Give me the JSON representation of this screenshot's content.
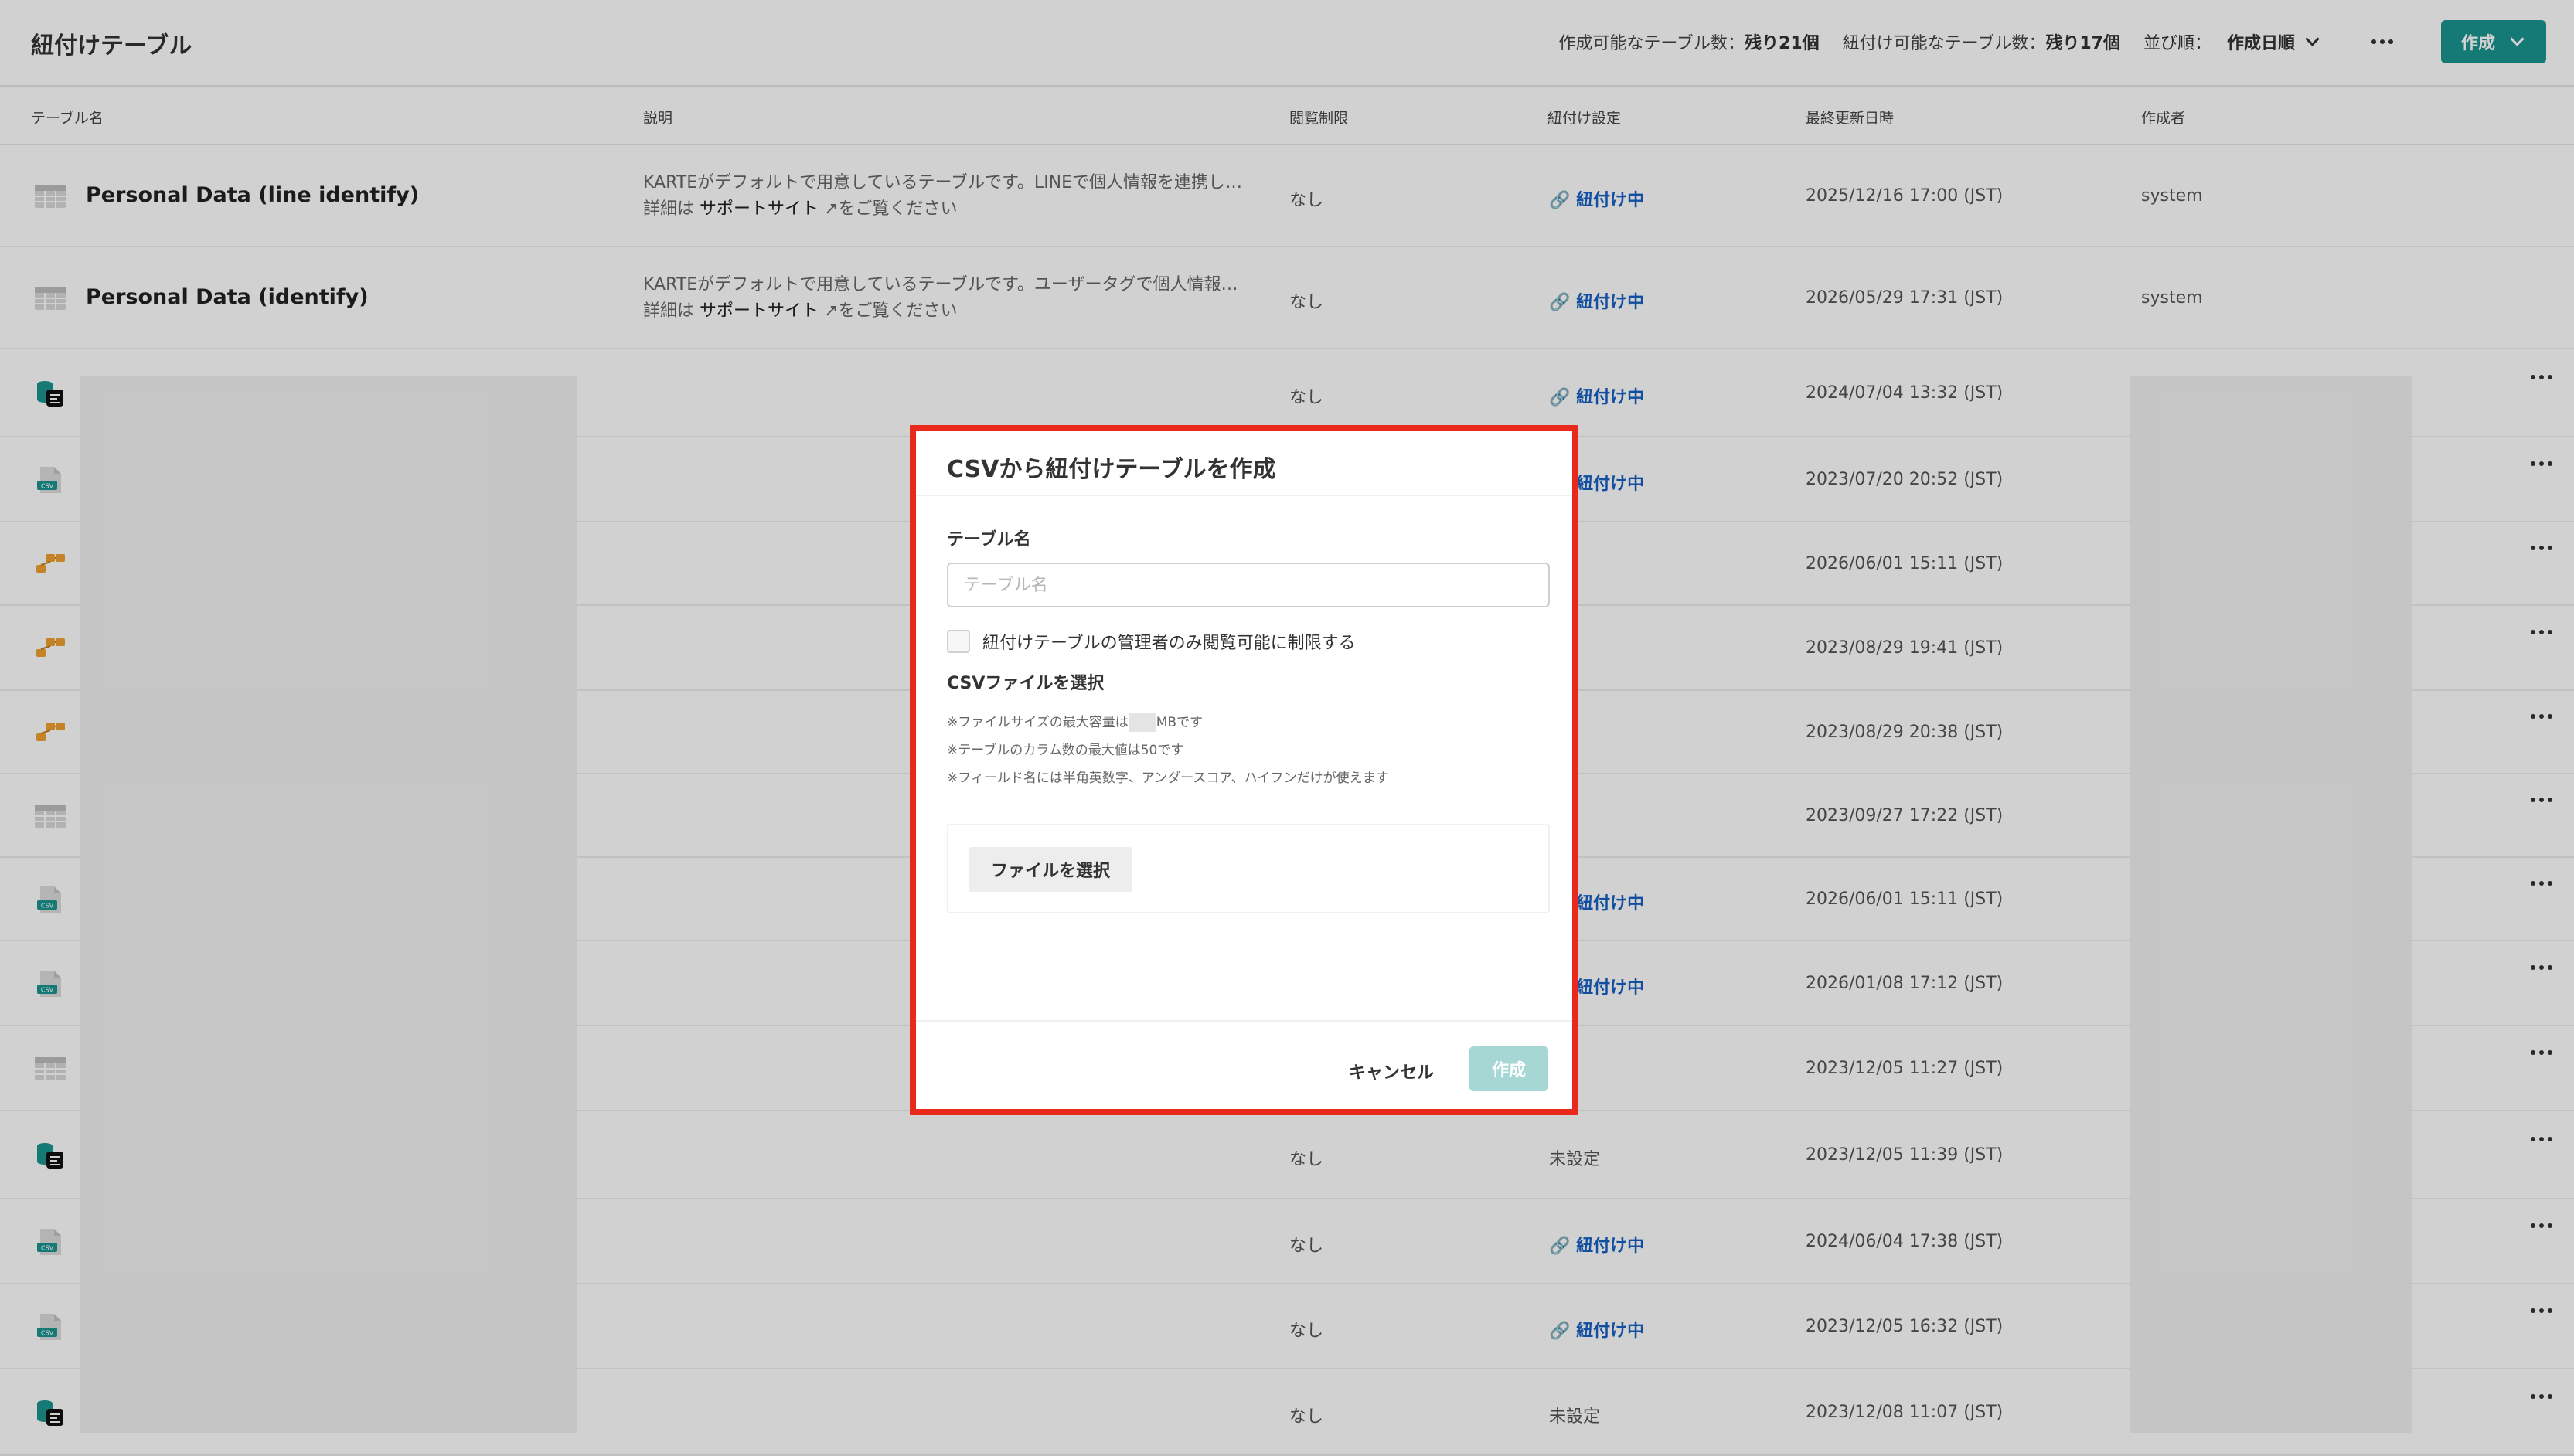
{
  "header": {
    "title": "紐付けテーブル",
    "creatable_label": "作成可能なテーブル数：",
    "creatable_value": "残り21個",
    "linkable_label": "紐付け可能なテーブル数：",
    "linkable_value": "残り17個",
    "sort_label": "並び順：",
    "sort_value": "作成日順",
    "create_button": "作成"
  },
  "columns": [
    "テーブル名",
    "説明",
    "閲覧制限",
    "紐付け設定",
    "最終更新日時",
    "作成者"
  ],
  "support_prefix": "詳細は",
  "support_link": "サポートサイト",
  "support_suffix": "をご覧ください",
  "rows": [
    {
      "icon": "table-icon",
      "name": "Personal Data (line identify)",
      "desc": "KARTEがデフォルトで用意しているテーブルです。LINEで個人情報を連携し…",
      "restriction": "なし",
      "link": "紐付け中",
      "updated": "2025/12/16 17:00 (JST)",
      "creator": "system"
    },
    {
      "icon": "table-icon",
      "name": "Personal Data (identify)",
      "desc": "KARTEがデフォルトで用意しているテーブルです。ユーザータグで個人情報…",
      "restriction": "なし",
      "link": "紐付け中",
      "updated": "2026/05/29 17:31 (JST)",
      "creator": "system"
    },
    {
      "icon": "datahub-icon",
      "restriction": "なし",
      "link": "紐付け中",
      "updated": "2024/07/04 13:32 (JST)"
    },
    {
      "icon": "csv-file-icon",
      "restriction": "",
      "link": "紐付け中",
      "updated": "2023/07/20 20:52 (JST)"
    },
    {
      "icon": "schema-icon",
      "restriction": "",
      "link": "定",
      "updated": "2026/06/01 15:11 (JST)"
    },
    {
      "icon": "schema-icon",
      "restriction": "",
      "link": "定",
      "updated": "2023/08/29 19:41 (JST)"
    },
    {
      "icon": "schema-icon",
      "restriction": "",
      "link": "定",
      "updated": "2023/08/29 20:38 (JST)"
    },
    {
      "icon": "table-icon",
      "restriction": "",
      "link": "定",
      "updated": "2023/09/27 17:22 (JST)"
    },
    {
      "icon": "csv-file-icon",
      "restriction": "",
      "link": "紐付け中",
      "updated": "2026/06/01 15:11 (JST)"
    },
    {
      "icon": "csv-file-icon",
      "restriction": "",
      "link": "紐付け中",
      "updated": "2026/01/08 17:12 (JST)"
    },
    {
      "icon": "table-icon",
      "restriction": "",
      "link": "定",
      "updated": "2023/12/05 11:27 (JST)"
    },
    {
      "icon": "datahub-icon",
      "restriction": "なし",
      "link": "未設定",
      "updated": "2023/12/05 11:39 (JST)"
    },
    {
      "icon": "csv-file-icon",
      "restriction": "なし",
      "link": "紐付け中",
      "updated": "2024/06/04 17:38 (JST)"
    },
    {
      "icon": "csv-file-icon",
      "restriction": "なし",
      "link": "紐付け中",
      "updated": "2023/12/05 16:32 (JST)"
    },
    {
      "icon": "datahub-icon",
      "restriction": "なし",
      "link": "未設定",
      "updated": "2023/12/08 11:07 (JST)"
    }
  ],
  "modal": {
    "title": "CSVから紐付けテーブルを作成",
    "name_label": "テーブル名",
    "name_placeholder": "テーブル名",
    "name_value": "",
    "restrict_label": "紐付けテーブルの管理者のみ閲覧可能に制限する",
    "restrict_checked": false,
    "file_section_label": "CSVファイルを選択",
    "note_size_prefix": "※ファイルサイズの最大容量は",
    "note_size_suffix": "MBです",
    "note_columns": "※テーブルのカラム数の最大値は50です",
    "note_fields": "※フィールド名には半角英数字、アンダースコア、ハイフンだけが使えます",
    "file_button": "ファイルを選択",
    "cancel_button": "キャンセル",
    "submit_button": "作成"
  }
}
